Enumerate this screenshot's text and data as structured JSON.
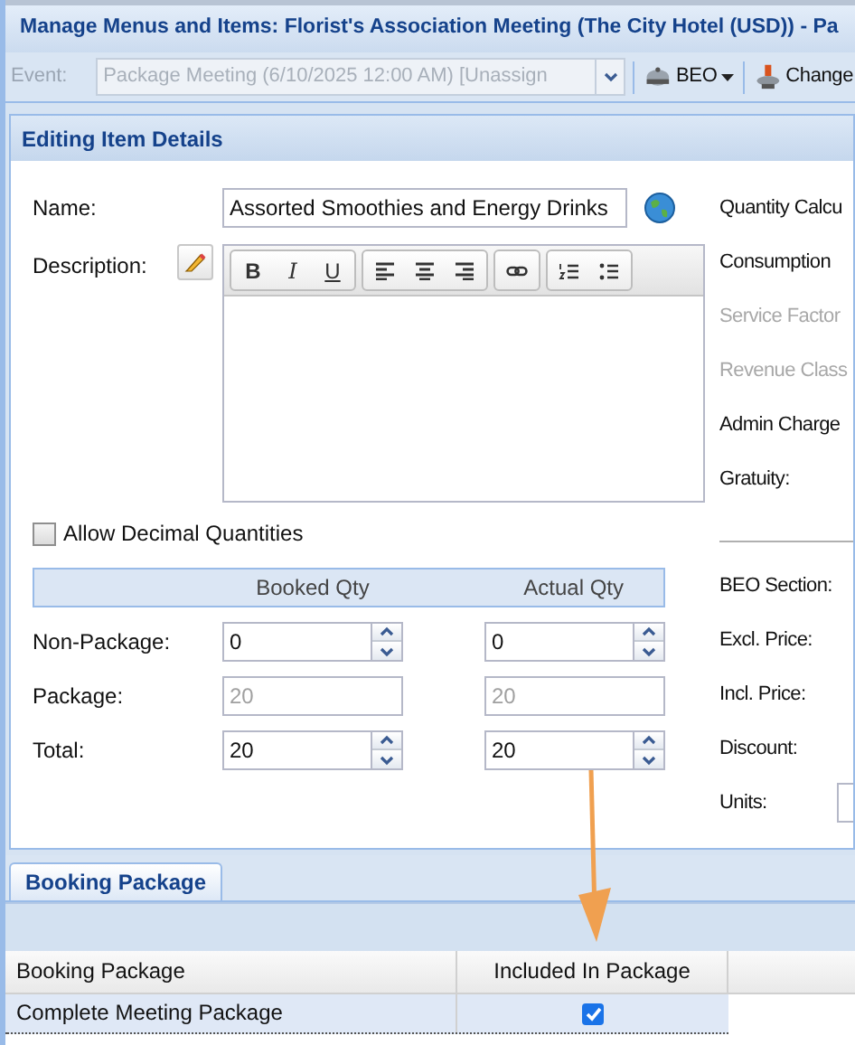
{
  "window": {
    "title": "Manage Menus and Items: Florist's Association Meeting (The City Hotel (USD)) - Pa"
  },
  "toolbar": {
    "event_label": "Event:",
    "event_value": "Package Meeting (6/10/2025 12:00 AM) [Unassign",
    "disabled": true,
    "buttons": [
      {
        "label": "BEO",
        "kind": "bell",
        "dropdown": true
      },
      {
        "label": "Change",
        "kind": "stamp",
        "dropdown": false
      }
    ]
  },
  "panel": {
    "title": "Editing Item Details",
    "name": {
      "label": "Name:",
      "value": "Assorted Smoothies and Energy Drinks"
    },
    "description": {
      "label": "Description:",
      "format_buttons": [
        "B",
        "I",
        "U"
      ]
    },
    "allow_decimal": {
      "label": "Allow Decimal Quantities",
      "checked": false
    },
    "qty": {
      "columns": [
        "Booked Qty",
        "Actual Qty"
      ],
      "rows": [
        {
          "label": "Non-Package:",
          "booked": "0",
          "actual": "0",
          "disabled": false
        },
        {
          "label": "Package:",
          "booked": "20",
          "actual": "20",
          "disabled": true
        },
        {
          "label": "Total:",
          "booked": "20",
          "actual": "20",
          "disabled": false
        }
      ]
    },
    "right_fields_top": [
      {
        "label": "Quantity Calcu",
        "disabled": false
      },
      {
        "label": "Consumption",
        "disabled": false
      },
      {
        "label": "Service Factor",
        "disabled": true
      },
      {
        "label": "Revenue Class",
        "disabled": true
      },
      {
        "label": "Admin Charge",
        "disabled": false
      },
      {
        "label": "Gratuity:",
        "disabled": false
      }
    ],
    "right_fields_bottom": [
      {
        "label": "BEO Section:",
        "kind": "label"
      },
      {
        "label": "Excl. Price:",
        "kind": "label"
      },
      {
        "label": "Incl. Price:",
        "kind": "label"
      },
      {
        "label": "Discount:",
        "kind": "label"
      },
      {
        "label": "Units:",
        "kind": "field"
      }
    ]
  },
  "bottom_tabs": [
    {
      "label": "Booking Package",
      "selected": true
    }
  ],
  "grid": {
    "columns": [
      "Booking Package",
      "Included In Package"
    ],
    "rows": [
      {
        "package": "Complete Meeting Package",
        "included": true,
        "selected": true
      }
    ]
  }
}
